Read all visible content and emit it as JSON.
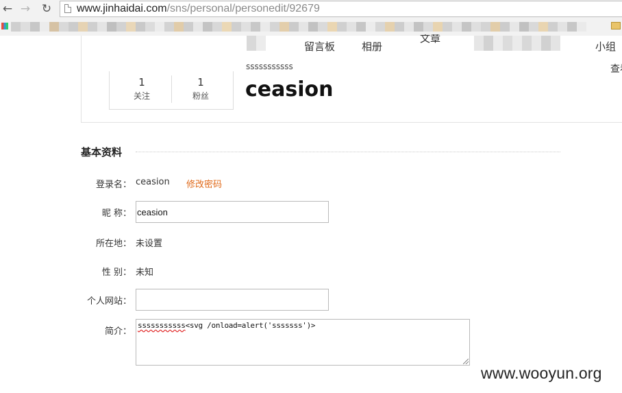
{
  "browser": {
    "url_host": "www.jinhaidai.com",
    "url_path": "/sns/personal/personedit/92679",
    "icons": {
      "back": "back-arrow-icon",
      "forward": "forward-arrow-icon",
      "reload": "reload-icon",
      "page": "page-icon",
      "bookmark_folder": "folder-icon",
      "apps": "apps-icon"
    }
  },
  "profile": {
    "tabs": [
      "留言板",
      "相册",
      "小组"
    ],
    "tabs_partial": [
      "文章"
    ],
    "right_link": "查看",
    "stats": [
      {
        "value": "1",
        "label": "关注"
      },
      {
        "value": "1",
        "label": "粉丝"
      }
    ],
    "signature": "sssssssssss",
    "username": "ceasion"
  },
  "form": {
    "section_title": "基本资料",
    "login_label": "登录名：",
    "login_value": "ceasion",
    "change_password": "修改密码",
    "nickname_label": "昵 称：",
    "nickname_value": "ceasion",
    "location_label": "所在地：",
    "location_value": "未设置",
    "gender_label": "性 别：",
    "gender_value": "未知",
    "website_label": "个人网站：",
    "website_value": "",
    "bio_label": "简介：",
    "bio_value_underlined": "sssssssssss",
    "bio_value_rest": "<svg /onload=alert('sssssss')>"
  },
  "watermark": "www.wooyun.org",
  "colors": {
    "link_orange": "#e06a1a",
    "chrome_bg": "#f2f2f2",
    "border": "#b9b9b9"
  }
}
